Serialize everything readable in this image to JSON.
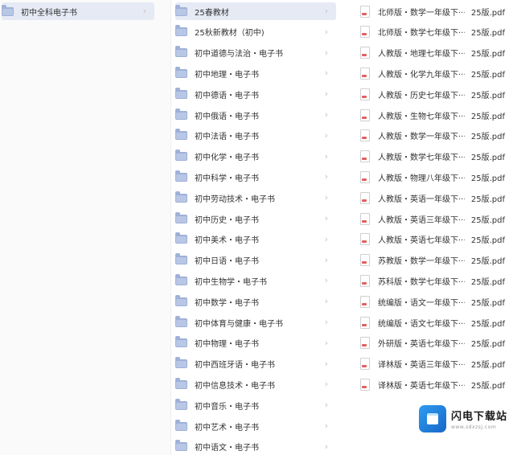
{
  "column1": {
    "items": [
      {
        "label": "初中全科电子书",
        "selected": true
      }
    ]
  },
  "column2": {
    "items": [
      {
        "label": "25春教材",
        "selected": true
      },
      {
        "label": "25秋新教材（初中)"
      },
      {
        "label": "初中道德与法治・电子书"
      },
      {
        "label": "初中地理・电子书"
      },
      {
        "label": "初中德语・电子书"
      },
      {
        "label": "初中俄语・电子书"
      },
      {
        "label": "初中法语・电子书"
      },
      {
        "label": "初中化学・电子书"
      },
      {
        "label": "初中科学・电子书"
      },
      {
        "label": "初中劳动技术・电子书"
      },
      {
        "label": "初中历史・电子书"
      },
      {
        "label": "初中美术・电子书"
      },
      {
        "label": "初中日语・电子书"
      },
      {
        "label": "初中生物学・电子书"
      },
      {
        "label": "初中数学・电子书"
      },
      {
        "label": "初中体育与健康・电子书"
      },
      {
        "label": "初中物理・电子书"
      },
      {
        "label": "初中西班牙语・电子书"
      },
      {
        "label": "初中信息技术・电子书"
      },
      {
        "label": "初中音乐・电子书"
      },
      {
        "label": "初中艺术・电子书"
      },
      {
        "label": "初中语文・电子书"
      }
    ]
  },
  "column3": {
    "items": [
      {
        "name": "北师版・数学一年级下···",
        "ext": "25版.pdf"
      },
      {
        "name": "北师版・数学七年级下···",
        "ext": "25版.pdf"
      },
      {
        "name": "人教版・地理七年级下···",
        "ext": "25版.pdf"
      },
      {
        "name": "人教版・化学九年级下···",
        "ext": "25版.pdf"
      },
      {
        "name": "人教版・历史七年级下···",
        "ext": "25版.pdf"
      },
      {
        "name": "人教版・生物七年级下···",
        "ext": "25版.pdf"
      },
      {
        "name": "人教版・数学一年级下···",
        "ext": "25版.pdf"
      },
      {
        "name": "人教版・数学七年级下···",
        "ext": "25版.pdf"
      },
      {
        "name": "人教版・物理八年级下···",
        "ext": "25版.pdf"
      },
      {
        "name": "人教版・英语一年级下···",
        "ext": "25版.pdf"
      },
      {
        "name": "人教版・英语三年级下···",
        "ext": "25版.pdf"
      },
      {
        "name": "人教版・英语七年级下···",
        "ext": "25版.pdf"
      },
      {
        "name": "苏教版・数学一年级下···",
        "ext": "25版.pdf"
      },
      {
        "name": "苏科版・数学七年级下···",
        "ext": "25版.pdf"
      },
      {
        "name": "统编版・语文一年级下···",
        "ext": "25版.pdf"
      },
      {
        "name": "统编版・语文七年级下···",
        "ext": "25版.pdf"
      },
      {
        "name": "外研版・英语七年级下···",
        "ext": "25版.pdf"
      },
      {
        "name": "译林版・英语三年级下···",
        "ext": "25版.pdf"
      },
      {
        "name": "译林版・英语七年级下···",
        "ext": "25版.pdf"
      }
    ]
  },
  "icons": {
    "folder": "folder-icon",
    "pdf": "pdf-file-icon",
    "chevron": "chevron-right-icon"
  },
  "colors": {
    "selected_row": "#e6eaf5",
    "folder": "#9fb1d8",
    "watermark_blue": "#1767c9"
  },
  "watermark": {
    "name": "闪电下载站",
    "url": "www.sdxzsj.com"
  }
}
